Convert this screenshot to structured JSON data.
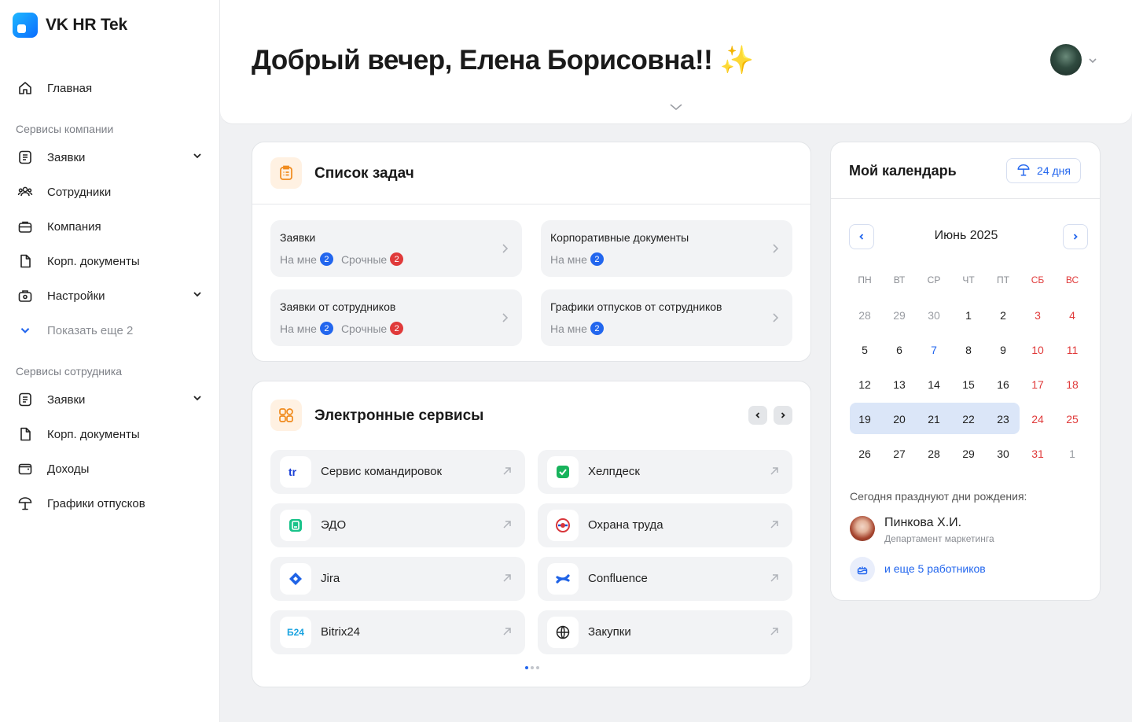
{
  "app": {
    "name": "VK HR Tek"
  },
  "sidebar": {
    "home": "Главная",
    "company_section": "Сервисы компании",
    "company_items": [
      "Заявки",
      "Сотрудники",
      "Компания",
      "Корп. документы",
      "Настройки"
    ],
    "show_more": "Показать еще 2",
    "employee_section": "Сервисы сотрудника",
    "employee_items": [
      "Заявки",
      "Корп. документы",
      "Доходы",
      "Графики отпусков"
    ]
  },
  "header": {
    "greeting": "Добрый вечер, Елена Борисовна!! ✨"
  },
  "tasks": {
    "title": "Список задач",
    "items": [
      {
        "title": "Заявки",
        "mine_label": "На мне",
        "mine": "2",
        "urgent_label": "Срочные",
        "urgent": "2"
      },
      {
        "title": "Корпоративные документы",
        "mine_label": "На мне",
        "mine": "2"
      },
      {
        "title": "Заявки от сотрудников",
        "mine_label": "На мне",
        "mine": "2",
        "urgent_label": "Срочные",
        "urgent": "2"
      },
      {
        "title": "Графики отпусков от сотрудников",
        "mine_label": "На мне",
        "mine": "2"
      }
    ]
  },
  "services": {
    "title": "Электронные сервисы",
    "items": [
      {
        "label": "Сервис командировок",
        "icon": "trip-service-icon"
      },
      {
        "label": "Хелпдеск",
        "icon": "helpdesk-icon"
      },
      {
        "label": "ЭДО",
        "icon": "edo-icon"
      },
      {
        "label": "Охрана труда",
        "icon": "labor-safety-icon"
      },
      {
        "label": "Jira",
        "icon": "jira-icon"
      },
      {
        "label": "Confluence",
        "icon": "confluence-icon"
      },
      {
        "label": "Bitrix24",
        "icon": "bitrix24-icon",
        "icon_text": "Б24"
      },
      {
        "label": "Закупки",
        "icon": "globe-icon"
      }
    ]
  },
  "calendar": {
    "title": "Мой календарь",
    "days_left": "24 дня",
    "month": "Июнь 2025",
    "weekdays": [
      "ПН",
      "ВТ",
      "СР",
      "ЧТ",
      "ПТ",
      "СБ",
      "ВС"
    ],
    "weeks": [
      [
        "28",
        "29",
        "30",
        "1",
        "2",
        "3",
        "4"
      ],
      [
        "5",
        "6",
        "7",
        "8",
        "9",
        "10",
        "11"
      ],
      [
        "12",
        "13",
        "14",
        "15",
        "16",
        "17",
        "18"
      ],
      [
        "19",
        "20",
        "21",
        "22",
        "23",
        "24",
        "25"
      ],
      [
        "26",
        "27",
        "28",
        "29",
        "30",
        "31",
        "1"
      ]
    ],
    "birthdays_title": "Сегодня празднуют дни рождения:",
    "birthday_person": {
      "name": "Пинкова Х.И.",
      "department": "Департамент маркетинга"
    },
    "more_link": "и еще 5 работников"
  },
  "colors": {
    "accent": "#2266ee",
    "weekend": "#e03a3a",
    "week_highlight": "#dbe6f8",
    "badge_red": "#e03a3a"
  }
}
